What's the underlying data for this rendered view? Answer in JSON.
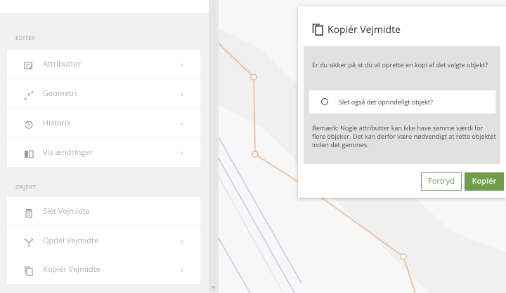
{
  "sidebar": {
    "section_edit": "EDITER",
    "section_object": "OBJEKT",
    "edit_items": [
      {
        "label": "Attributter",
        "icon": "form-edit-icon",
        "chevron": "›"
      },
      {
        "label": "Geometri",
        "icon": "geometry-icon",
        "chevron": "›"
      },
      {
        "label": "Historik",
        "icon": "history-icon",
        "chevron": "›"
      },
      {
        "label": "Vis ændringer",
        "icon": "compare-icon",
        "chevron": "›"
      }
    ],
    "object_items": [
      {
        "label": "Slet Vejmidte",
        "icon": "trash-icon",
        "chevron": ""
      },
      {
        "label": "Opdel Vejmidte",
        "icon": "split-icon",
        "chevron": "›"
      },
      {
        "label": "Kopiér Vejmidte",
        "icon": "copy-icon",
        "chevron": "›"
      }
    ]
  },
  "dialog": {
    "title": "Kopiér Vejmidte",
    "question": "Er du sikker på at du vil oprette en kopi af det valgte objekt?",
    "option_label": "Slet også det oprindeligt objekt?",
    "note": "Bemærk: Nogle attributter kan ikke have samme værdi for flere objeker. Det kan derfor være nødvendigt at rette objektet inden det gemmes.",
    "cancel_label": "Fortryd",
    "confirm_label": "Kopiér"
  },
  "colors": {
    "accent_green": "#6f9d49",
    "road_line": "#f2c4a6",
    "road_node": "#f2b894",
    "blue_line": "#c9c8e6"
  }
}
